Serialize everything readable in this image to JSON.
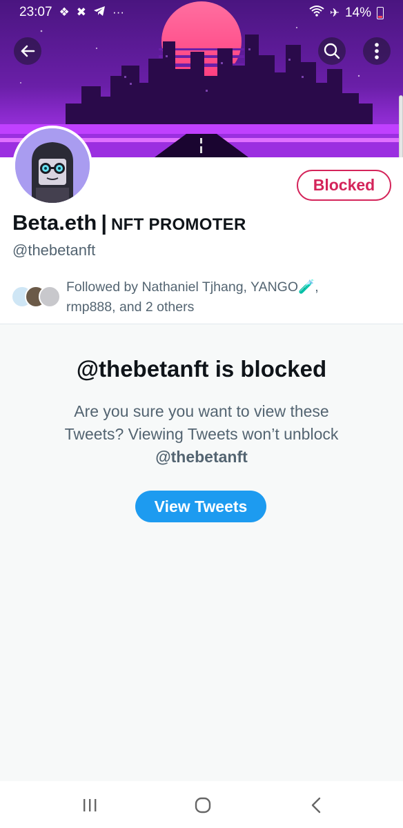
{
  "status_bar": {
    "time": "23:07",
    "left_icons": [
      "binance-icon",
      "crossed-tools-icon",
      "telegram-icon",
      "more-dots-icon"
    ],
    "right_icons": [
      "wifi-icon",
      "airplane-icon"
    ],
    "battery": "14%",
    "dots": "···"
  },
  "header": {
    "back_icon": "arrow-left-icon",
    "search_icon": "search-icon",
    "more_icon": "vertical-dots-icon"
  },
  "profile": {
    "blocked_label": "Blocked",
    "display_name": "Beta.eth",
    "separator": "|",
    "name_suffix": "NFT PROMOTER",
    "handle": "@thebetanft",
    "followed_by_line1": "Followed by Nathaniel Tjhang, YANGO🧪,",
    "followed_by_line2": "rmp888, and 2 others"
  },
  "notice": {
    "title": "@thebetanft is blocked",
    "body": "Are you sure you want to view these Tweets? Viewing Tweets won’t unblock",
    "handle": "@thebetanft",
    "button_label": "View Tweets"
  },
  "nav": {
    "recents_label": "|||",
    "home_icon": "home-circle-icon",
    "back_icon": "back-chevron-icon"
  },
  "colors": {
    "blocked_red": "#d4245a",
    "twitter_blue": "#1d9bf0",
    "banner_purple": "#6a1fa8"
  }
}
